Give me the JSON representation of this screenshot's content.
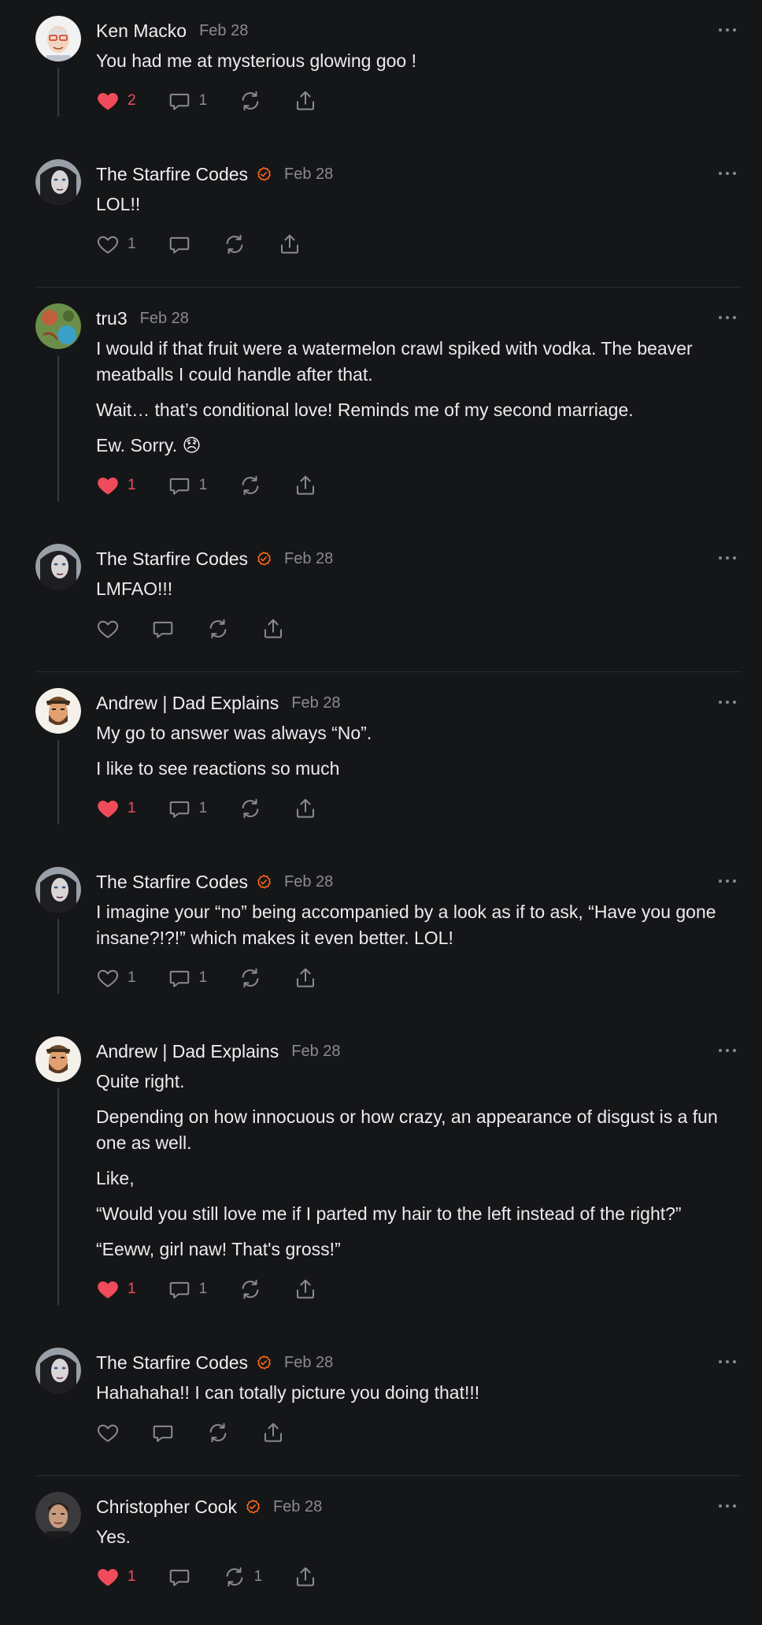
{
  "comments": [
    {
      "author": "Ken Macko",
      "verified": false,
      "date": "Feb 28",
      "paragraphs": [
        "You had me at mysterious glowing goo !"
      ],
      "likes": "2",
      "liked": true,
      "replies": "1",
      "restacks": "",
      "avatar": "ken",
      "thread": true,
      "divider_after": false
    },
    {
      "author": "The Starfire Codes",
      "verified": true,
      "date": "Feb 28",
      "paragraphs": [
        "LOL!!"
      ],
      "likes": "1",
      "liked": false,
      "replies": "",
      "restacks": "",
      "avatar": "starfire",
      "thread": false,
      "divider_after": true
    },
    {
      "author": "tru3",
      "verified": false,
      "date": "Feb 28",
      "paragraphs": [
        "I would if that fruit were a watermelon crawl spiked with vodka. The beaver meatballs I could handle after that.",
        "Wait… that’s conditional love! Reminds me of my second marriage.",
        "Ew. Sorry. 😞"
      ],
      "likes": "1",
      "liked": true,
      "replies": "1",
      "restacks": "",
      "avatar": "tru3",
      "thread": true,
      "divider_after": false
    },
    {
      "author": "The Starfire Codes",
      "verified": true,
      "date": "Feb 28",
      "paragraphs": [
        "LMFAO!!!"
      ],
      "likes": "",
      "liked": false,
      "replies": "",
      "restacks": "",
      "avatar": "starfire",
      "thread": false,
      "divider_after": true
    },
    {
      "author": "Andrew | Dad Explains",
      "verified": false,
      "date": "Feb 28",
      "paragraphs": [
        "My go to answer was always “No”.",
        "I like to see reactions so much"
      ],
      "likes": "1",
      "liked": true,
      "replies": "1",
      "restacks": "",
      "avatar": "andrew",
      "thread": true,
      "divider_after": false
    },
    {
      "author": "The Starfire Codes",
      "verified": true,
      "date": "Feb 28",
      "paragraphs": [
        "I imagine your “no” being accompanied by a look as if to ask, “Have you gone insane?!?!” which makes it even better. LOL!"
      ],
      "likes": "1",
      "liked": false,
      "replies": "1",
      "restacks": "",
      "avatar": "starfire",
      "thread": true,
      "divider_after": false
    },
    {
      "author": "Andrew | Dad Explains",
      "verified": false,
      "date": "Feb 28",
      "paragraphs": [
        "Quite right.",
        "Depending on how innocuous or how crazy, an appearance of disgust is a fun one as well.",
        "Like,",
        "“Would you still love me if I parted my hair to the left instead of the right?”",
        "“Eeww, girl naw! That's gross!”"
      ],
      "likes": "1",
      "liked": true,
      "replies": "1",
      "restacks": "",
      "avatar": "andrew",
      "thread": true,
      "divider_after": false
    },
    {
      "author": "The Starfire Codes",
      "verified": true,
      "date": "Feb 28",
      "paragraphs": [
        "Hahahaha!! I can totally picture you doing that!!!"
      ],
      "likes": "",
      "liked": false,
      "replies": "",
      "restacks": "",
      "avatar": "starfire",
      "thread": false,
      "divider_after": true
    },
    {
      "author": "Christopher Cook",
      "verified": true,
      "date": "Feb 28",
      "paragraphs": [
        "Yes."
      ],
      "likes": "1",
      "liked": true,
      "replies": "",
      "restacks": "1",
      "avatar": "chris",
      "thread": false,
      "divider_after": false
    }
  ],
  "icons": {
    "like": "heart-icon",
    "reply": "comment-bubble-icon",
    "restack": "restack-icon",
    "share": "share-icon",
    "more": "more-dots-icon",
    "verified": "verified-check-icon"
  },
  "colors": {
    "background": "#151618",
    "liked": "#ef4b5b",
    "verified": "#ff6719",
    "muted": "#8a8b90"
  }
}
